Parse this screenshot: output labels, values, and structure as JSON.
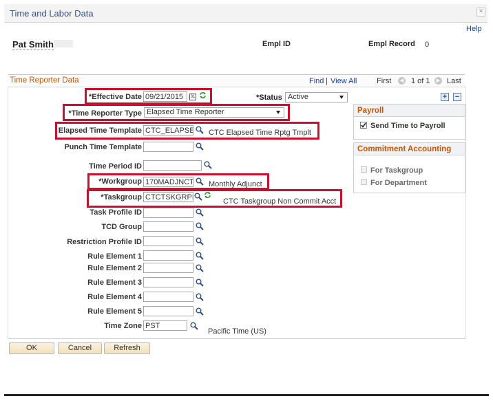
{
  "window": {
    "title": "Time and Labor Data",
    "help_label": "Help"
  },
  "header": {
    "employee_name": "Pat Smith",
    "empl_id_label": "Empl ID",
    "empl_record_label": "Empl Record",
    "empl_record_value": "0"
  },
  "section": {
    "title": "Time Reporter Data",
    "find_label": "Find",
    "view_all_label": "View All",
    "separator": "|",
    "first_label": "First",
    "page_indicator": "1 of 1",
    "last_label": "Last"
  },
  "fields": {
    "effective_date": {
      "label": "*Effective Date",
      "value": "09/21/2015"
    },
    "status": {
      "label": "*Status",
      "value": "Active"
    },
    "time_reporter_type": {
      "label": "*Time Reporter Type",
      "value": "Elapsed Time Reporter"
    },
    "elapsed_time_template": {
      "label": "Elapsed Time Template",
      "value": "CTC_ELAPSE",
      "description": "CTC Elapsed Time Rptg Tmplt"
    },
    "punch_time_template": {
      "label": "Punch Time Template",
      "value": ""
    },
    "time_period_id": {
      "label": "Time Period ID",
      "value": ""
    },
    "workgroup": {
      "label": "*Workgroup",
      "value": "170MADJNCT",
      "description": "Monthly Adjunct"
    },
    "taskgroup": {
      "label": "*Taskgroup",
      "value": "CTCTSKGRPN",
      "description": "CTC Taskgroup Non Commit Acct"
    },
    "task_profile_id": {
      "label": "Task Profile ID",
      "value": ""
    },
    "tcd_group": {
      "label": "TCD Group",
      "value": ""
    },
    "restriction_profile_id": {
      "label": "Restriction Profile ID",
      "value": ""
    },
    "rule_element_1": {
      "label": "Rule Element 1",
      "value": ""
    },
    "rule_element_2": {
      "label": "Rule Element 2",
      "value": ""
    },
    "rule_element_3": {
      "label": "Rule Element 3",
      "value": ""
    },
    "rule_element_4": {
      "label": "Rule Element 4",
      "value": ""
    },
    "rule_element_5": {
      "label": "Rule Element 5",
      "value": ""
    },
    "time_zone": {
      "label": "Time Zone",
      "value": "PST",
      "description": "Pacific Time (US)"
    }
  },
  "payroll": {
    "title": "Payroll",
    "send_time_label": "Send Time to Payroll",
    "send_time_checked": true
  },
  "commitment": {
    "title": "Commitment Accounting",
    "for_taskgroup_label": "For Taskgroup",
    "for_department_label": "For Department"
  },
  "row_actions": {
    "add": "+",
    "remove": "−"
  },
  "buttons": {
    "ok": "OK",
    "cancel": "Cancel",
    "refresh": "Refresh"
  },
  "icons": {
    "lookup": "magnifier-icon",
    "calendar": "calendar-icon",
    "refresh": "refresh-arrows-icon",
    "close": "close-icon",
    "first": "left-arrow-circle-icon",
    "last": "right-arrow-circle-icon"
  },
  "colors": {
    "highlight_border": "#c8102e",
    "section_title": "#cc5500",
    "link": "#1c3f94"
  }
}
